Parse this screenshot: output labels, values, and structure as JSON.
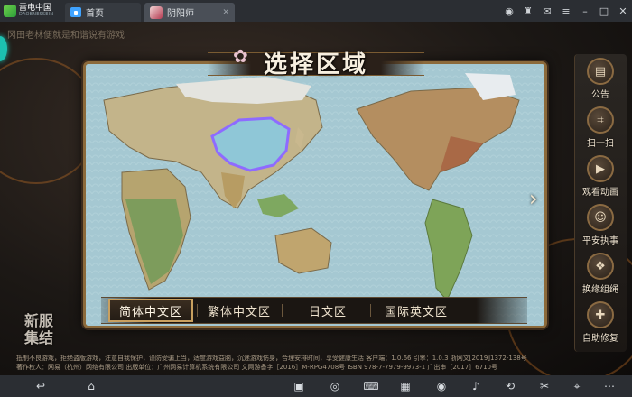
{
  "emulator": {
    "brand_name": "雷电中国",
    "brand_sub": "DAOBNESSEIN",
    "tabs": [
      {
        "label": "首页"
      },
      {
        "label": "阴阳师"
      }
    ],
    "top_icons": [
      "gamepad-icon",
      "shirt-icon",
      "mail-icon",
      "menu-icon",
      "minimize-icon",
      "maximize-icon",
      "close-icon"
    ],
    "bottom_icons": [
      "back-icon",
      "home-icon",
      "screen-record-icon",
      "gamepad-icon",
      "keyboard-icon",
      "eye-icon",
      "volume-icon",
      "rotate-icon",
      "scissors-icon",
      "location-icon",
      "more-icon"
    ]
  },
  "game": {
    "top_line": "冈田老林便就是和谐说有游戏",
    "title": "选择区域",
    "regions": [
      {
        "label": "简体中文区",
        "active": true
      },
      {
        "label": "繁体中文区",
        "active": false
      },
      {
        "label": "日文区",
        "active": false
      },
      {
        "label": "国际英文区",
        "active": false
      }
    ],
    "side_menu": [
      {
        "label": "公告",
        "icon": "notice-icon"
      },
      {
        "label": "扫一扫",
        "icon": "scan-icon"
      },
      {
        "label": "观看动画",
        "icon": "animation-icon"
      },
      {
        "label": "平安执事",
        "icon": "butler-icon"
      },
      {
        "label": "换缘组绳",
        "icon": "rope-icon"
      },
      {
        "label": "自助修复",
        "icon": "repair-icon"
      }
    ],
    "new_server": [
      "新服",
      "集结"
    ],
    "footer": [
      "抵制不良游戏，拒绝盗版游戏，注意自我保护，谨防受骗上当，适度游戏益脑，沉迷游戏伤身，合理安排时间，享受健康生活  客户端：1.0.66  引擎：1.0.3  浙网文[2019]1372-138号",
      "著作权人：网易（杭州）网络有限公司      出版单位：广州网易计算机系统有限公司      文网游备字［2016］M-RPG4708号      ISBN 978-7-7979-9973-1      广出审［2017］6710号"
    ],
    "colors": {
      "accent": "#c9a05f",
      "china_highlight": "#8e6bff"
    }
  }
}
